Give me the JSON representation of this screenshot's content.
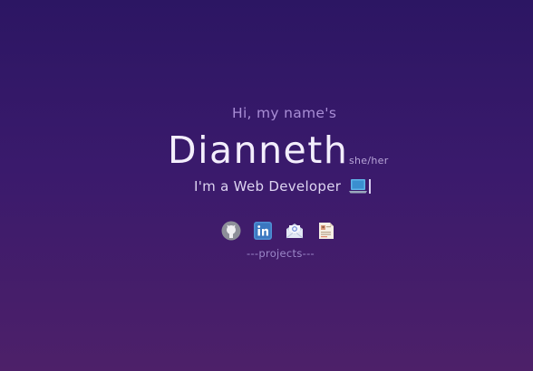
{
  "intro": {
    "greeting": "Hi, my name's",
    "name": "Dianneth",
    "pronouns": "she/her",
    "tagline": "I'm a Web Developer"
  },
  "links": [
    {
      "icon": "github-icon"
    },
    {
      "icon": "linkedin-icon"
    },
    {
      "icon": "email-icon"
    },
    {
      "icon": "resume-icon"
    }
  ],
  "projects_link": "---projects---",
  "colors": {
    "background_top": "#2c1663",
    "background_bottom": "#4d2069",
    "greeting": "#a98ed6",
    "name": "#f3eefc"
  }
}
